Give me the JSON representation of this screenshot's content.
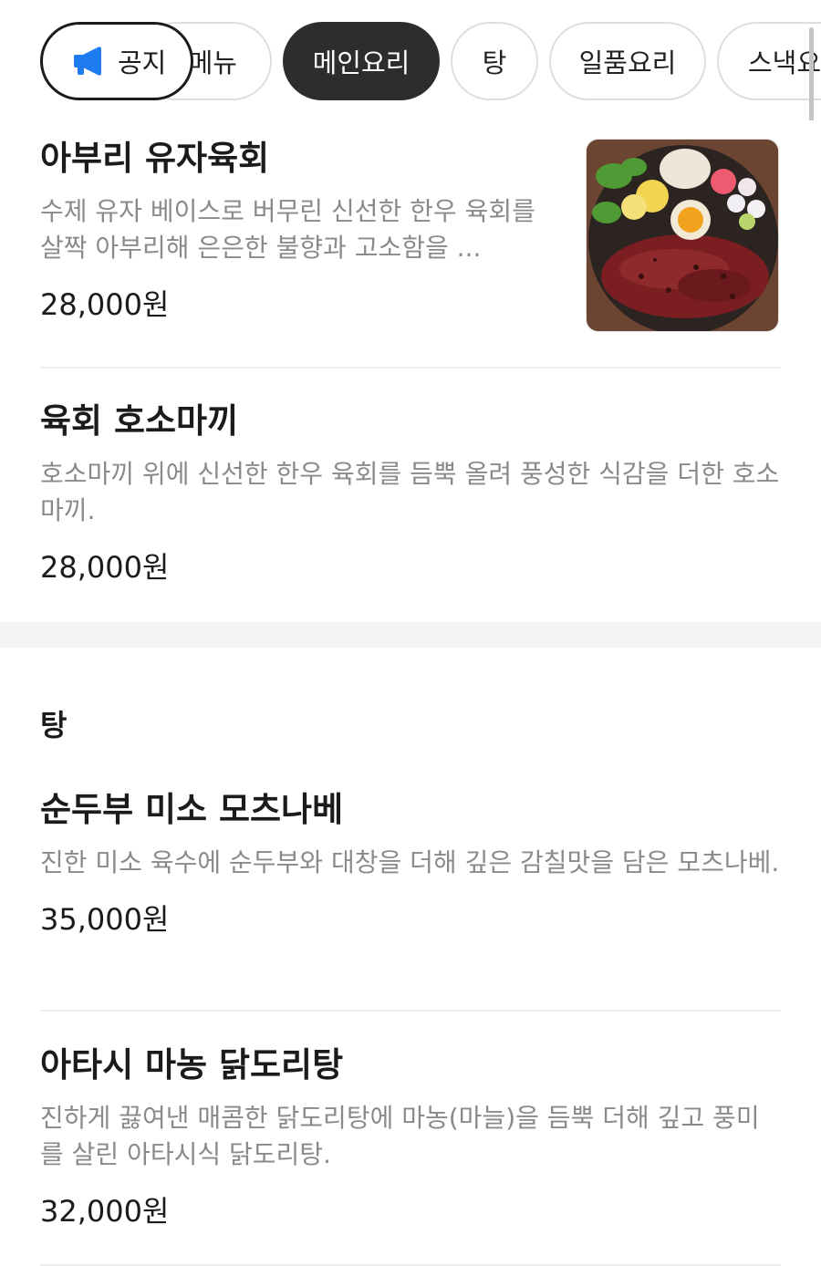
{
  "tabs": {
    "notice_label": "공지",
    "items": [
      {
        "label": "메뉴"
      },
      {
        "label": "메인요리"
      },
      {
        "label": "탕"
      },
      {
        "label": "일품요리"
      },
      {
        "label": "스낵요리"
      }
    ],
    "active_index": 1
  },
  "main_dishes": [
    {
      "name": "아부리 유자육회",
      "description": "수제 유자 베이스로 버무린 신선한 한우 육회를 살짝 아부리해 은은한 불향과 고소함을 ...",
      "price": "28,000원",
      "image": "beef-tartare-photo"
    },
    {
      "name": "육회 호소마끼",
      "description": "호소마끼 위에 신선한 한우 육회를 듬뿍 올려 풍성한 식감을 더한 호소마끼.",
      "price": "28,000원"
    }
  ],
  "tang_section": {
    "title": "탕",
    "items": [
      {
        "name": "순두부 미소 모츠나베",
        "description": "진한 미소 육수에 순두부와 대창을 더해 깊은 감칠맛을 담은 모츠나베.",
        "price": "35,000원"
      },
      {
        "name": "아타시 마농 닭도리탕",
        "description": "진하게 끓여낸 매콤한 닭도리탕에 마농(마늘)을 듬뿍 더해 깊고 풍미를 살린 아타시식 닭도리탕.",
        "price": "32,000원"
      }
    ]
  },
  "colors": {
    "active_tab_bg": "#2d2d2f",
    "notice_icon": "#1e7bf0",
    "description_text": "#8a8a8a"
  }
}
